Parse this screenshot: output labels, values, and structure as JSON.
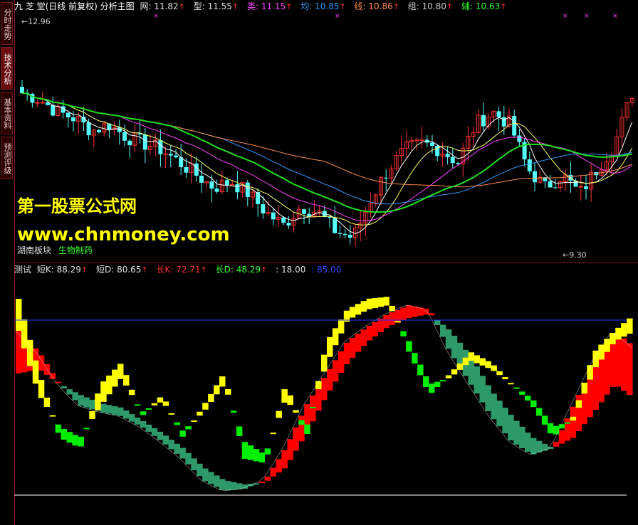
{
  "sidebar": {
    "tabs": [
      {
        "label": "分时走势",
        "active": false
      },
      {
        "label": "技术分析",
        "active": true
      },
      {
        "label": "基本资料",
        "active": false
      },
      {
        "label": "预测评级",
        "active": false
      }
    ]
  },
  "main_header": {
    "title": "九 芝 堂(日线 前复权) 分析主图",
    "items": [
      {
        "label": "网: 11.82",
        "color": "#e0e0e0",
        "arrow": "↑"
      },
      {
        "label": "型: 11.55",
        "color": "#e0e0e0",
        "arrow": "↑"
      },
      {
        "label": "类: 11.15",
        "color": "#ff40ff",
        "arrow": "↑"
      },
      {
        "label": "均: 10.85",
        "color": "#3399ff",
        "arrow": "↑"
      },
      {
        "label": "线: 10.86",
        "color": "#ff8c50",
        "arrow": "↑"
      },
      {
        "label": "组: 10.80",
        "color": "#c8c8c8",
        "arrow": "↑"
      },
      {
        "label": "辅: 10.63",
        "color": "#33ff33",
        "arrow": "↑"
      }
    ]
  },
  "price_labels": {
    "high": "12.96",
    "low": "9.30"
  },
  "brand": {
    "line1": "第一股票公式网",
    "line2": "www.chnmoney.com"
  },
  "sector": {
    "board": "湖南板块",
    "industry": "生物制药"
  },
  "sub_header": {
    "title": "测试",
    "items": [
      {
        "label": "短K: 88.29",
        "color": "#e0e0e0",
        "arrow": "↑"
      },
      {
        "label": "短D: 80.65",
        "color": "#e0e0e0",
        "arrow": "↑"
      },
      {
        "label": "长K: 72.71",
        "color": "#ff3030",
        "arrow": "↑"
      },
      {
        "label": "长D: 48.29",
        "color": "#33ff33",
        "arrow": "↑"
      },
      {
        "label": ": 18.00",
        "color": "#e0e0e0",
        "arrow": ""
      },
      {
        "label": ": 85.00",
        "color": "#3344ff",
        "arrow": ""
      }
    ]
  },
  "colors": {
    "up_candle": "#ff3030",
    "down_candle": "#55ffff",
    "ma_green": "#22dd22",
    "short_k": "#ffff00",
    "short_d": "#00ee00",
    "long_k": "#ff0000",
    "long_d": "#2e9a6a",
    "line_85": "#2233ff",
    "line_18": "#ffffff"
  },
  "chart_data": [
    {
      "type": "candlestick",
      "title": "九 芝 堂(日线 前复权) 分析主图",
      "ylim": [
        9.3,
        12.96
      ],
      "series": [
        {
          "name": "网",
          "values": [
            11.82
          ]
        },
        {
          "name": "型",
          "values": [
            11.55
          ]
        },
        {
          "name": "类",
          "values": [
            11.15
          ]
        },
        {
          "name": "均",
          "values": [
            10.85
          ]
        },
        {
          "name": "线",
          "values": [
            10.86
          ]
        },
        {
          "name": "组",
          "values": [
            10.8
          ]
        },
        {
          "name": "辅",
          "values": [
            10.63
          ]
        }
      ]
    },
    {
      "type": "area",
      "title": "测试",
      "ylim": [
        0,
        100
      ],
      "series": [
        {
          "name": "短K",
          "values": [
            88.29
          ]
        },
        {
          "name": "短D",
          "values": [
            80.65
          ]
        },
        {
          "name": "长K",
          "values": [
            72.71
          ]
        },
        {
          "name": "长D",
          "values": [
            48.29
          ]
        }
      ],
      "reference_lines": [
        18.0,
        85.0
      ]
    }
  ]
}
